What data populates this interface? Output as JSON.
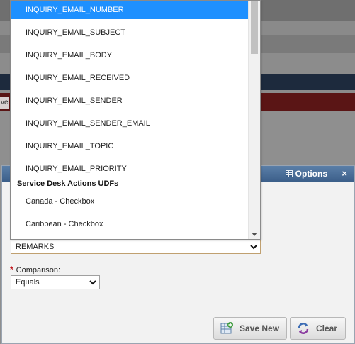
{
  "background": {
    "partial_text": "ve"
  },
  "dialog": {
    "options_label": "Options",
    "close_label": "×",
    "field_value": "REMARKS",
    "comparison_label": "Comparison:",
    "required_marker": "*",
    "comparison_value": "Equals",
    "save_new_label": "Save New",
    "clear_label": "Clear"
  },
  "dropdown": {
    "items": [
      "INQUIRY_EMAIL_NUMBER",
      "INQUIRY_EMAIL_SUBJECT",
      "INQUIRY_EMAIL_BODY",
      "INQUIRY_EMAIL_RECEIVED",
      "INQUIRY_EMAIL_SENDER",
      "INQUIRY_EMAIL_SENDER_EMAIL",
      "INQUIRY_EMAIL_TOPIC",
      "INQUIRY_EMAIL_PRIORITY"
    ],
    "group_label": "Service Desk Actions UDFs",
    "group_items": [
      "Canada - Checkbox",
      "Caribbean - Checkbox"
    ],
    "selected_index": 0
  },
  "colors": {
    "selection": "#1e90ff",
    "dialog_header": "#3c5f8a",
    "required": "#c0141c",
    "field_border": "#c0a070"
  }
}
